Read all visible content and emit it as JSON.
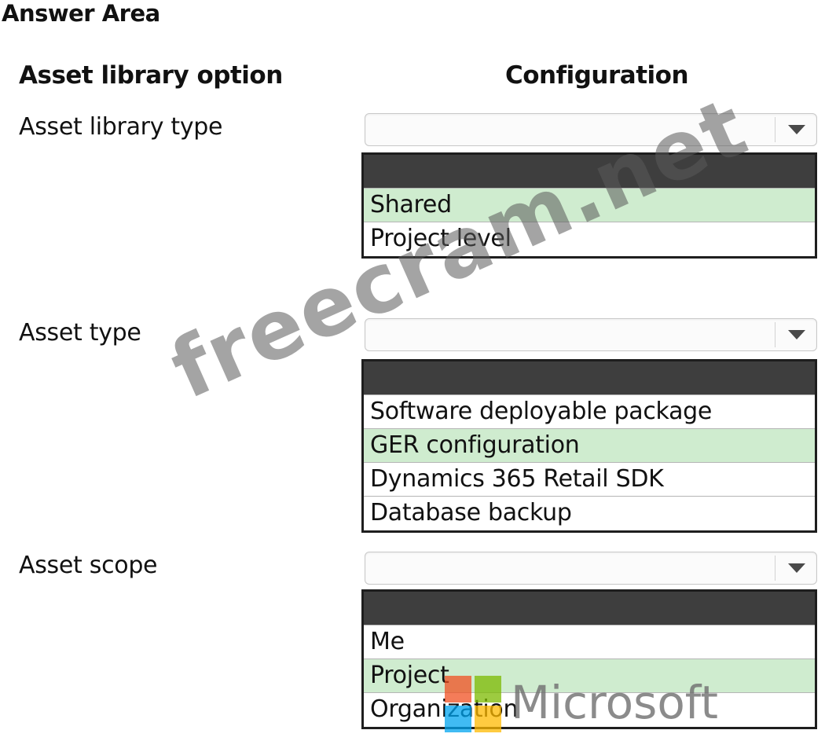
{
  "title": "Answer Area",
  "headers": {
    "left": "Asset library option",
    "right": "Configuration"
  },
  "rows": [
    {
      "label": "Asset library type",
      "options": [
        "Shared",
        "Project level"
      ],
      "selected": "Shared"
    },
    {
      "label": "Asset type",
      "options": [
        "Software deployable package",
        "GER configuration",
        "Dynamics 365 Retail SDK",
        "Database backup"
      ],
      "selected": "GER configuration"
    },
    {
      "label": "Asset scope",
      "options": [
        "Me",
        "Project",
        "Organization"
      ],
      "selected": "Project"
    }
  ],
  "watermark": {
    "text": "freecram.net"
  },
  "logo": {
    "text": "Microsoft",
    "icon": "microsoft-logo-icon"
  },
  "colors": {
    "selected_bg": "#cfeccf",
    "dropdown_header": "#3e3e3e"
  }
}
